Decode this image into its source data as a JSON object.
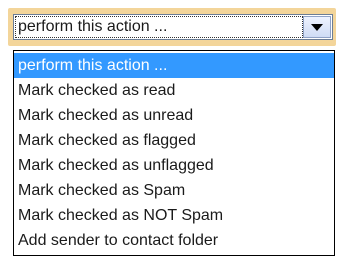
{
  "select": {
    "current_value": "perform this action ...",
    "selected_index": 0,
    "options": [
      "perform this action ...",
      "Mark checked as read",
      "Mark checked as unread",
      "Mark checked as flagged",
      "Mark checked as unflagged",
      "Mark checked as Spam",
      "Mark checked as NOT Spam",
      "Add sender to contact folder"
    ]
  },
  "colors": {
    "highlight": "#3399ff",
    "frame_background": "#f3d59a"
  },
  "icons": {
    "dropdown_button": "chevron-down-icon"
  }
}
